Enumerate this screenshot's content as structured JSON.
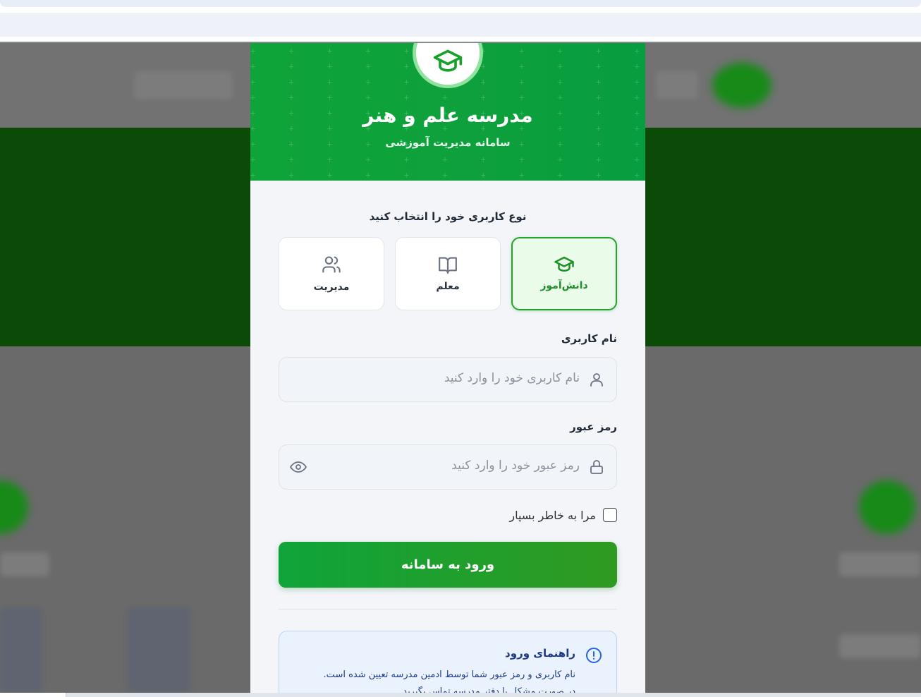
{
  "school": {
    "name": "مدرسه علم و هنر",
    "subtitle": "سامانه مدیریت آموزشی"
  },
  "login": {
    "choose_user_type": "نوع کاربری خود را انتخاب کنید",
    "roles": [
      {
        "id": "student",
        "label": "دانش‌آموز",
        "icon": "graduation-cap-icon",
        "selected": true
      },
      {
        "id": "teacher",
        "label": "معلم",
        "icon": "book-open-icon",
        "selected": false
      },
      {
        "id": "admin",
        "label": "مدیریت",
        "icon": "users-icon",
        "selected": false
      }
    ],
    "username": {
      "label": "نام کاربری",
      "placeholder": "نام کاربری خود را وارد کنید",
      "value": ""
    },
    "password": {
      "label": "رمز عبور",
      "placeholder": "رمز عبور خود را وارد کنید",
      "value": ""
    },
    "remember_me": {
      "label": "مرا به خاطر بسپار",
      "checked": false
    },
    "submit_label": "ورود به سامانه"
  },
  "guide": {
    "title": "راهنمای ورود",
    "line1": "نام کاربری و رمز عبور شما توسط ادمین مدرسه تعیین شده است.",
    "line2": "در صورت مشکل با دفتر مدرسه تماس بگیرید."
  },
  "colors": {
    "brand_green": "#0fa43a",
    "selected_role_border": "#22a32c",
    "guide_blue": "#1e3a8a"
  }
}
